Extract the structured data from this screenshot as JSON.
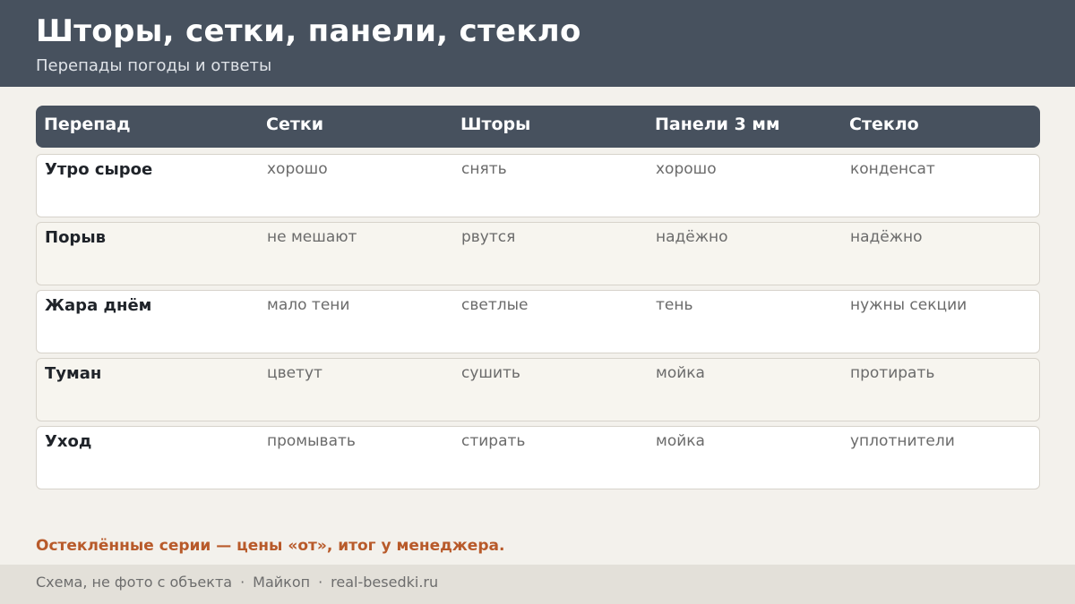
{
  "header": {
    "title": "Шторы, сетки, панели, стекло",
    "subtitle": "Перепады погоды и ответы"
  },
  "table": {
    "columns": [
      "Перепад",
      "Сетки",
      "Шторы",
      "Панели 3 мм",
      "Стекло"
    ],
    "rows": [
      [
        "Утро сырое",
        "хорошо",
        "снять",
        "хорошо",
        "конденсат"
      ],
      [
        "Порыв",
        "не мешают",
        "рвутся",
        "надёжно",
        "надёжно"
      ],
      [
        "Жара днём",
        "мало тени",
        "светлые",
        "тень",
        "нужны секции"
      ],
      [
        "Туман",
        "цветут",
        "сушить",
        "мойка",
        "протирать"
      ],
      [
        "Уход",
        "промывать",
        "стирать",
        "мойка",
        "уплотнители"
      ]
    ]
  },
  "note": "Остеклённые серии — цены «от», итог у менеджера.",
  "footer": {
    "items": [
      "Схема, не фото с объекта",
      "Майкоп",
      "real-besedki.ru"
    ],
    "separator": "·"
  },
  "colors": {
    "header_bg": "#47515e",
    "accent": "#b85a2a",
    "page_bg": "#f3f1ec"
  }
}
